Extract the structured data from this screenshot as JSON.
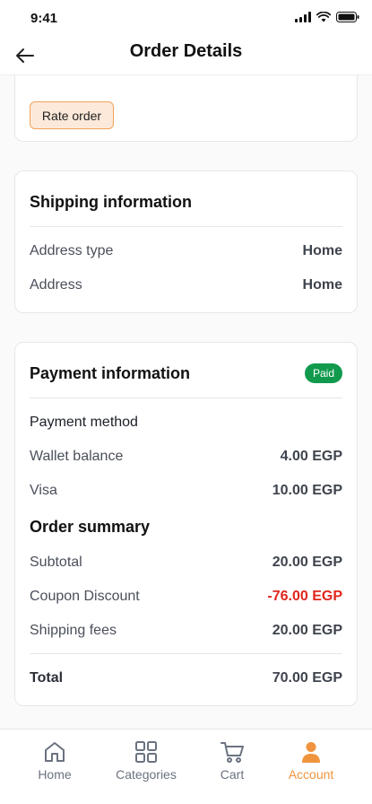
{
  "status": {
    "time": "9:41"
  },
  "header": {
    "title": "Order Details"
  },
  "order_actions": {
    "rate_order": "Rate order"
  },
  "shipping": {
    "title": "Shipping information",
    "rows": [
      {
        "label": "Address type",
        "value": "Home"
      },
      {
        "label": "Address",
        "value": "Home"
      }
    ]
  },
  "payment": {
    "title": "Payment information",
    "status_badge": "Paid",
    "method_title": "Payment method",
    "methods": [
      {
        "label": "Wallet balance",
        "value": "4.00 EGP"
      },
      {
        "label": "Visa",
        "value": "10.00 EGP"
      }
    ],
    "summary_title": "Order summary",
    "summary": [
      {
        "label": "Subtotal",
        "value": "20.00 EGP"
      },
      {
        "label": "Coupon Discount",
        "value": "-76.00 EGP"
      },
      {
        "label": "Shipping fees",
        "value": "20.00 EGP"
      }
    ],
    "total": {
      "label": "Total",
      "value": "70.00 EGP"
    }
  },
  "tabbar": {
    "tabs": [
      {
        "label": "Home",
        "icon": "home-icon"
      },
      {
        "label": "Categories",
        "icon": "grid-icon"
      },
      {
        "label": "Cart",
        "icon": "cart-icon"
      },
      {
        "label": "Account",
        "icon": "user-icon"
      }
    ],
    "active": "Account"
  },
  "colors": {
    "accent": "#f0943e",
    "paid": "#119a4d",
    "negative": "#e0261d"
  }
}
